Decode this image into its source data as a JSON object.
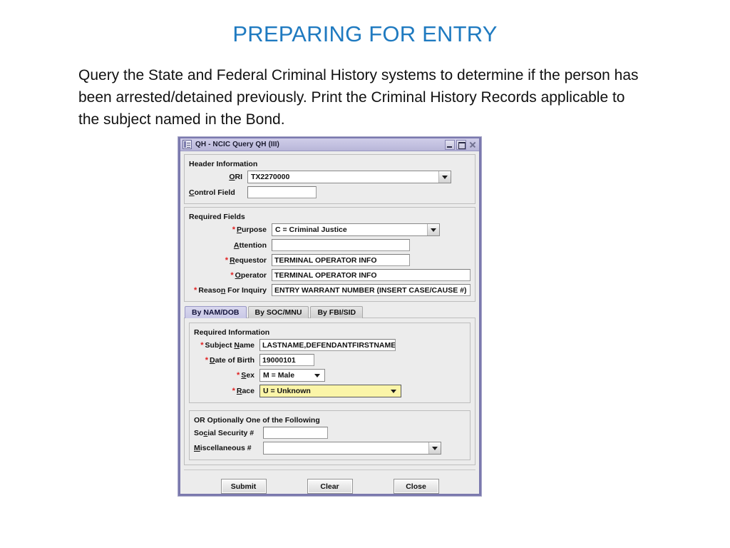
{
  "slide": {
    "title": "PREPARING FOR ENTRY",
    "body": "Query the State and Federal Criminal History systems to determine if the person has been arrested/detained previously.  Print the Criminal History Records applicable to the subject named in the Bond.",
    "title_color": "#1F7AC0"
  },
  "dialog": {
    "titlebar": {
      "text": "QH - NCIC Query QH (III)",
      "icon": "window-document-icon",
      "minimize": "minimize-icon",
      "maximize": "maximize-icon",
      "close": "close-icon"
    },
    "header_information": {
      "legend": "Header Information",
      "ori": {
        "label": "ORI",
        "mnemonic": "O",
        "value": "TX2270000",
        "type": "combo"
      },
      "control_field": {
        "label": "Control Field",
        "mnemonic": "C",
        "value": "",
        "type": "text"
      }
    },
    "required_fields": {
      "legend": "Required Fields",
      "fields": [
        {
          "label": "Purpose",
          "mnemonic": "P",
          "required": true,
          "value": "C = Criminal Justice",
          "type": "combo"
        },
        {
          "label": "Attention",
          "mnemonic": "A",
          "required": false,
          "value": "",
          "type": "text"
        },
        {
          "label": "Requestor",
          "mnemonic": "R",
          "required": true,
          "value": "TERMINAL OPERATOR INFO",
          "type": "text"
        },
        {
          "label": "Operator",
          "mnemonic": "O",
          "required": true,
          "value": "TERMINAL OPERATOR INFO",
          "type": "text"
        },
        {
          "label": "Reason For Inquiry",
          "mnemonic": "n",
          "required": true,
          "value": "ENTRY WARRANT NUMBER (INSERT CASE/CAUSE #)",
          "type": "text"
        }
      ]
    },
    "tabs": [
      {
        "label": "By NAM/DOB",
        "active": true
      },
      {
        "label": "By SOC/MNU",
        "active": false
      },
      {
        "label": "By FBI/SID",
        "active": false
      }
    ],
    "required_information": {
      "legend": "Required Information",
      "fields": [
        {
          "label": "Subject Name",
          "mnemonic": "N",
          "required": true,
          "value": "LASTNAME,DEFENDANTFIRSTNAME",
          "type": "text"
        },
        {
          "label": "Date of Birth",
          "mnemonic": "D",
          "required": true,
          "value": "19000101",
          "type": "text"
        },
        {
          "label": "Sex",
          "mnemonic": "S",
          "required": true,
          "value": "M = Male",
          "type": "combo"
        },
        {
          "label": "Race",
          "mnemonic": "R",
          "required": true,
          "value": "U = Unknown",
          "type": "combo",
          "highlighted": true,
          "highlight_color": "#FBF5A8"
        }
      ]
    },
    "optional_section": {
      "legend": "OR Optionally One of the Following",
      "fields": [
        {
          "label": "Social Security #",
          "mnemonic": "c",
          "value": "",
          "type": "text"
        },
        {
          "label": "Miscellaneous #",
          "mnemonic": "M",
          "value": "",
          "type": "combo"
        }
      ]
    },
    "buttons": [
      {
        "label": "Submit"
      },
      {
        "label": "Clear"
      },
      {
        "label": "Close"
      }
    ]
  }
}
